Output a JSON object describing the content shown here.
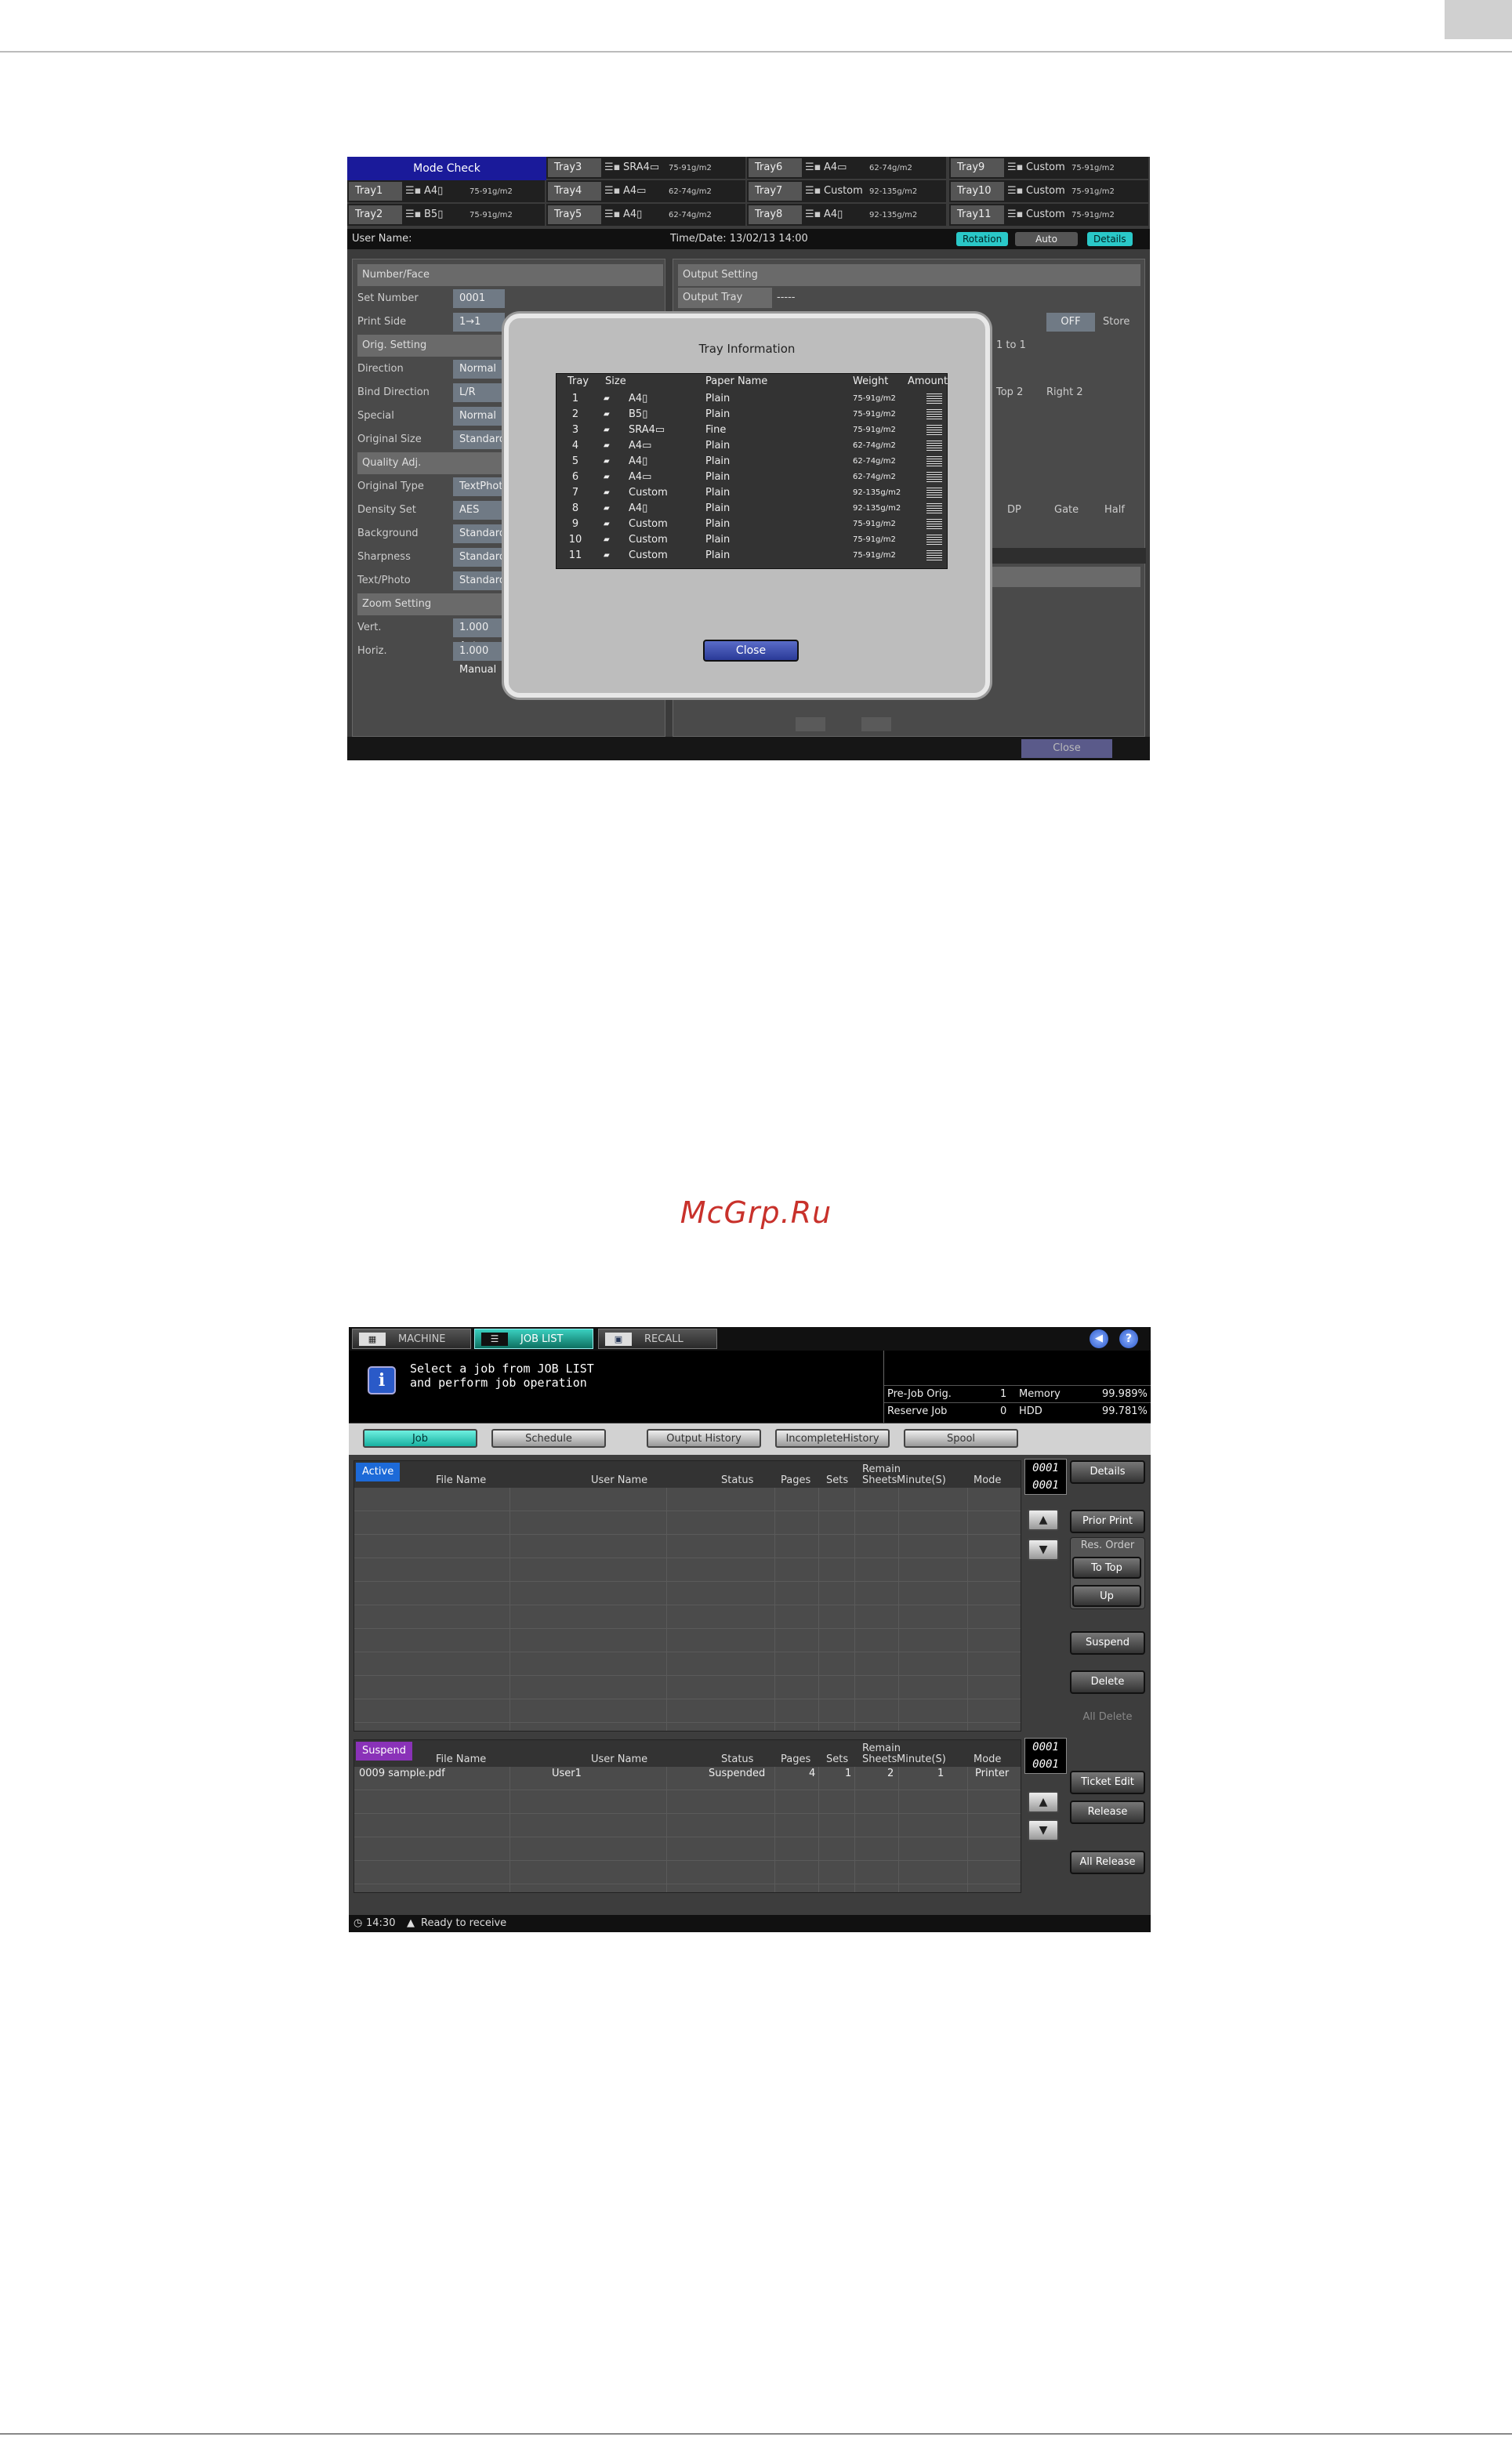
{
  "screen1": {
    "mode_check": "Mode Check",
    "trays": [
      {
        "name": "Tray3",
        "size": "SRA4▭",
        "weight": "75-91g/m2"
      },
      {
        "name": "Tray6",
        "size": "A4▭",
        "weight": "62-74g/m2"
      },
      {
        "name": "Tray9",
        "size": "Custom",
        "weight": "75-91g/m2"
      },
      {
        "name": "Tray1",
        "size": "A4▯",
        "weight": "75-91g/m2"
      },
      {
        "name": "Tray4",
        "size": "A4▭",
        "weight": "62-74g/m2"
      },
      {
        "name": "Tray7",
        "size": "Custom",
        "weight": "92-135g/m2"
      },
      {
        "name": "Tray10",
        "size": "Custom",
        "weight": "75-91g/m2"
      },
      {
        "name": "Tray2",
        "size": "B5▯",
        "weight": "75-91g/m2"
      },
      {
        "name": "Tray5",
        "size": "A4▯",
        "weight": "62-74g/m2"
      },
      {
        "name": "Tray8",
        "size": "A4▯",
        "weight": "92-135g/m2"
      },
      {
        "name": "Tray11",
        "size": "Custom",
        "weight": "75-91g/m2"
      }
    ],
    "user_name_label": "User Name:",
    "time_date": "Time/Date:  13/02/13 14:00",
    "rotation": "Rotation",
    "auto": "Auto",
    "details": "Details",
    "left_panel": [
      {
        "label": "Number/Face",
        "value": "",
        "header": true
      },
      {
        "label": "Set Number",
        "value": "0001",
        "header": false
      },
      {
        "label": "Print Side",
        "value": "1→1",
        "header": false
      },
      {
        "label": "Orig. Setting",
        "value": "",
        "header": true
      },
      {
        "label": "Direction",
        "value": "Normal",
        "header": false
      },
      {
        "label": "Bind Direction",
        "value": "L/R",
        "header": false
      },
      {
        "label": "Special",
        "value": "Normal",
        "header": false
      },
      {
        "label": "Original Size",
        "value": "Standard",
        "header": false
      },
      {
        "label": "Quality Adj.",
        "value": "",
        "header": true
      },
      {
        "label": "Original Type",
        "value": "TextPhot",
        "header": false
      },
      {
        "label": "Density Set",
        "value": "AES",
        "header": false
      },
      {
        "label": "Background",
        "value": "Standard",
        "header": false
      },
      {
        "label": "Sharpness",
        "value": "Standard",
        "header": false
      },
      {
        "label": "Text/Photo",
        "value": "Standard",
        "header": false
      },
      {
        "label": "Zoom Setting",
        "value": "",
        "header": true
      },
      {
        "label": "Vert.",
        "value": "1.000  Auto",
        "header": false
      },
      {
        "label": "Horiz.",
        "value": "1.000  Manual",
        "header": false
      }
    ],
    "right_panel": {
      "output_setting": "Output Setting",
      "output_tray": "Output Tray",
      "output_tray_val": "-----",
      "off": "OFF",
      "store": "Store",
      "n_to_1": "1 to 1",
      "top2": "Top 2",
      "right2": "Right 2",
      "dp": "DP",
      "gate": "Gate",
      "half": "Half"
    },
    "footer_close": "Close",
    "dialog": {
      "title": "Tray Information",
      "headers": {
        "tray": "Tray",
        "size": "Size",
        "paper": "Paper Name",
        "weight": "Weight",
        "amount": "Amount"
      },
      "rows": [
        {
          "tray": "1",
          "size": "A4▯",
          "paper": "Plain",
          "weight": "75-91g/m2"
        },
        {
          "tray": "2",
          "size": "B5▯",
          "paper": "Plain",
          "weight": "75-91g/m2"
        },
        {
          "tray": "3",
          "size": "SRA4▭",
          "paper": "Fine",
          "weight": "75-91g/m2"
        },
        {
          "tray": "4",
          "size": "A4▭",
          "paper": "Plain",
          "weight": "62-74g/m2"
        },
        {
          "tray": "5",
          "size": "A4▯",
          "paper": "Plain",
          "weight": "62-74g/m2"
        },
        {
          "tray": "6",
          "size": "A4▭",
          "paper": "Plain",
          "weight": "62-74g/m2"
        },
        {
          "tray": "7",
          "size": "Custom",
          "paper": "Plain",
          "weight": "92-135g/m2"
        },
        {
          "tray": "8",
          "size": "A4▯",
          "paper": "Plain",
          "weight": "92-135g/m2"
        },
        {
          "tray": "9",
          "size": "Custom",
          "paper": "Plain",
          "weight": "75-91g/m2"
        },
        {
          "tray": "10",
          "size": "Custom",
          "paper": "Plain",
          "weight": "75-91g/m2"
        },
        {
          "tray": "11",
          "size": "Custom",
          "paper": "Plain",
          "weight": "75-91g/m2"
        }
      ],
      "close": "Close"
    }
  },
  "watermark": "McGrp.Ru",
  "screen2": {
    "tabs": {
      "machine": "MACHINE",
      "job_list": "JOB LIST",
      "recall": "RECALL"
    },
    "message_line1": "Select a job from JOB LIST",
    "message_line2": "and perform job operation",
    "stats": {
      "prejob_label": "Pre-Job Orig.",
      "prejob_val": "1",
      "memory_label": "Memory",
      "memory_val": "99.989%",
      "reserve_label": "Reserve Job",
      "reserve_val": "0",
      "hdd_label": "HDD",
      "hdd_val": "99.781%"
    },
    "filters": {
      "job": "Job",
      "schedule": "Schedule",
      "output_history": "Output History",
      "incomplete_history": "IncompleteHistory",
      "spool": "Spool"
    },
    "columns": {
      "file": "File Name",
      "user": "User Name",
      "status": "Status",
      "pages": "Pages",
      "sets": "Sets",
      "remain1": "Remain",
      "remain2": "Sheets",
      "minute": "Minute(S)",
      "mode": "Mode"
    },
    "active_label": "Active",
    "suspend_label": "Suspend",
    "counter_top": [
      "0001",
      "0001"
    ],
    "counter_bottom": [
      "0001",
      "0001"
    ],
    "suspend_rows": [
      {
        "file": "0009 sample.pdf",
        "user": "User1",
        "status": "Suspended",
        "pages": "4",
        "sets": "1",
        "remain": "2",
        "minute": "1",
        "mode": "Printer"
      }
    ],
    "buttons": {
      "details": "Details",
      "prior_print": "Prior Print",
      "res_order": "Res. Order",
      "to_top": "To Top",
      "up": "Up",
      "suspend": "Suspend",
      "delete": "Delete",
      "all_delete": "All Delete",
      "ticket_edit": "Ticket Edit",
      "release": "Release",
      "all_release": "All Release"
    },
    "status_time": "14:30",
    "status_text": "Ready to receive"
  }
}
